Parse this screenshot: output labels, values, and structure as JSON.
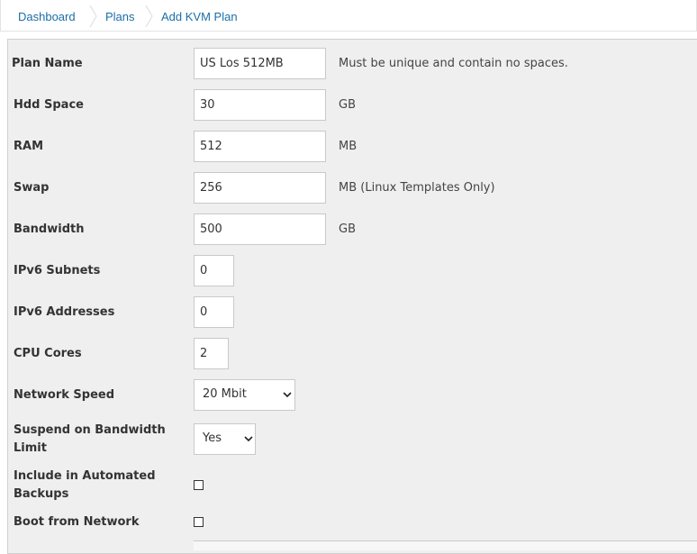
{
  "breadcrumb": {
    "dashboard": "Dashboard",
    "plans": "Plans",
    "current": "Add KVM Plan"
  },
  "form": {
    "plan_name": {
      "label": "Plan Name",
      "value": "US Los 512MB",
      "hint": "Must be unique and contain no spaces."
    },
    "hdd_space": {
      "label": "Hdd Space",
      "value": "30",
      "hint": "GB"
    },
    "ram": {
      "label": "RAM",
      "value": "512",
      "hint": "MB"
    },
    "swap": {
      "label": "Swap",
      "value": "256",
      "hint": "MB (Linux Templates Only)"
    },
    "bandwidth": {
      "label": "Bandwidth",
      "value": "500",
      "hint": "GB"
    },
    "ipv6_subnets": {
      "label": "IPv6 Subnets",
      "value": "0"
    },
    "ipv6_addresses": {
      "label": "IPv6 Addresses",
      "value": "0"
    },
    "cpu_cores": {
      "label": "CPU Cores",
      "value": "2"
    },
    "network_speed": {
      "label": "Network Speed",
      "value": "20 Mbit"
    },
    "suspend_bw": {
      "label_line1": "Suspend on Bandwidth",
      "label_line2": "Limit",
      "value": "Yes"
    },
    "auto_backups": {
      "label_line1": "Include in Automated",
      "label_line2": "Backups",
      "checked": false
    },
    "boot_network": {
      "label": "Boot from Network",
      "checked": false
    }
  },
  "colors": {
    "link": "#1a6ea8",
    "panel_bg": "#efefef",
    "border": "#c9c9c9"
  }
}
